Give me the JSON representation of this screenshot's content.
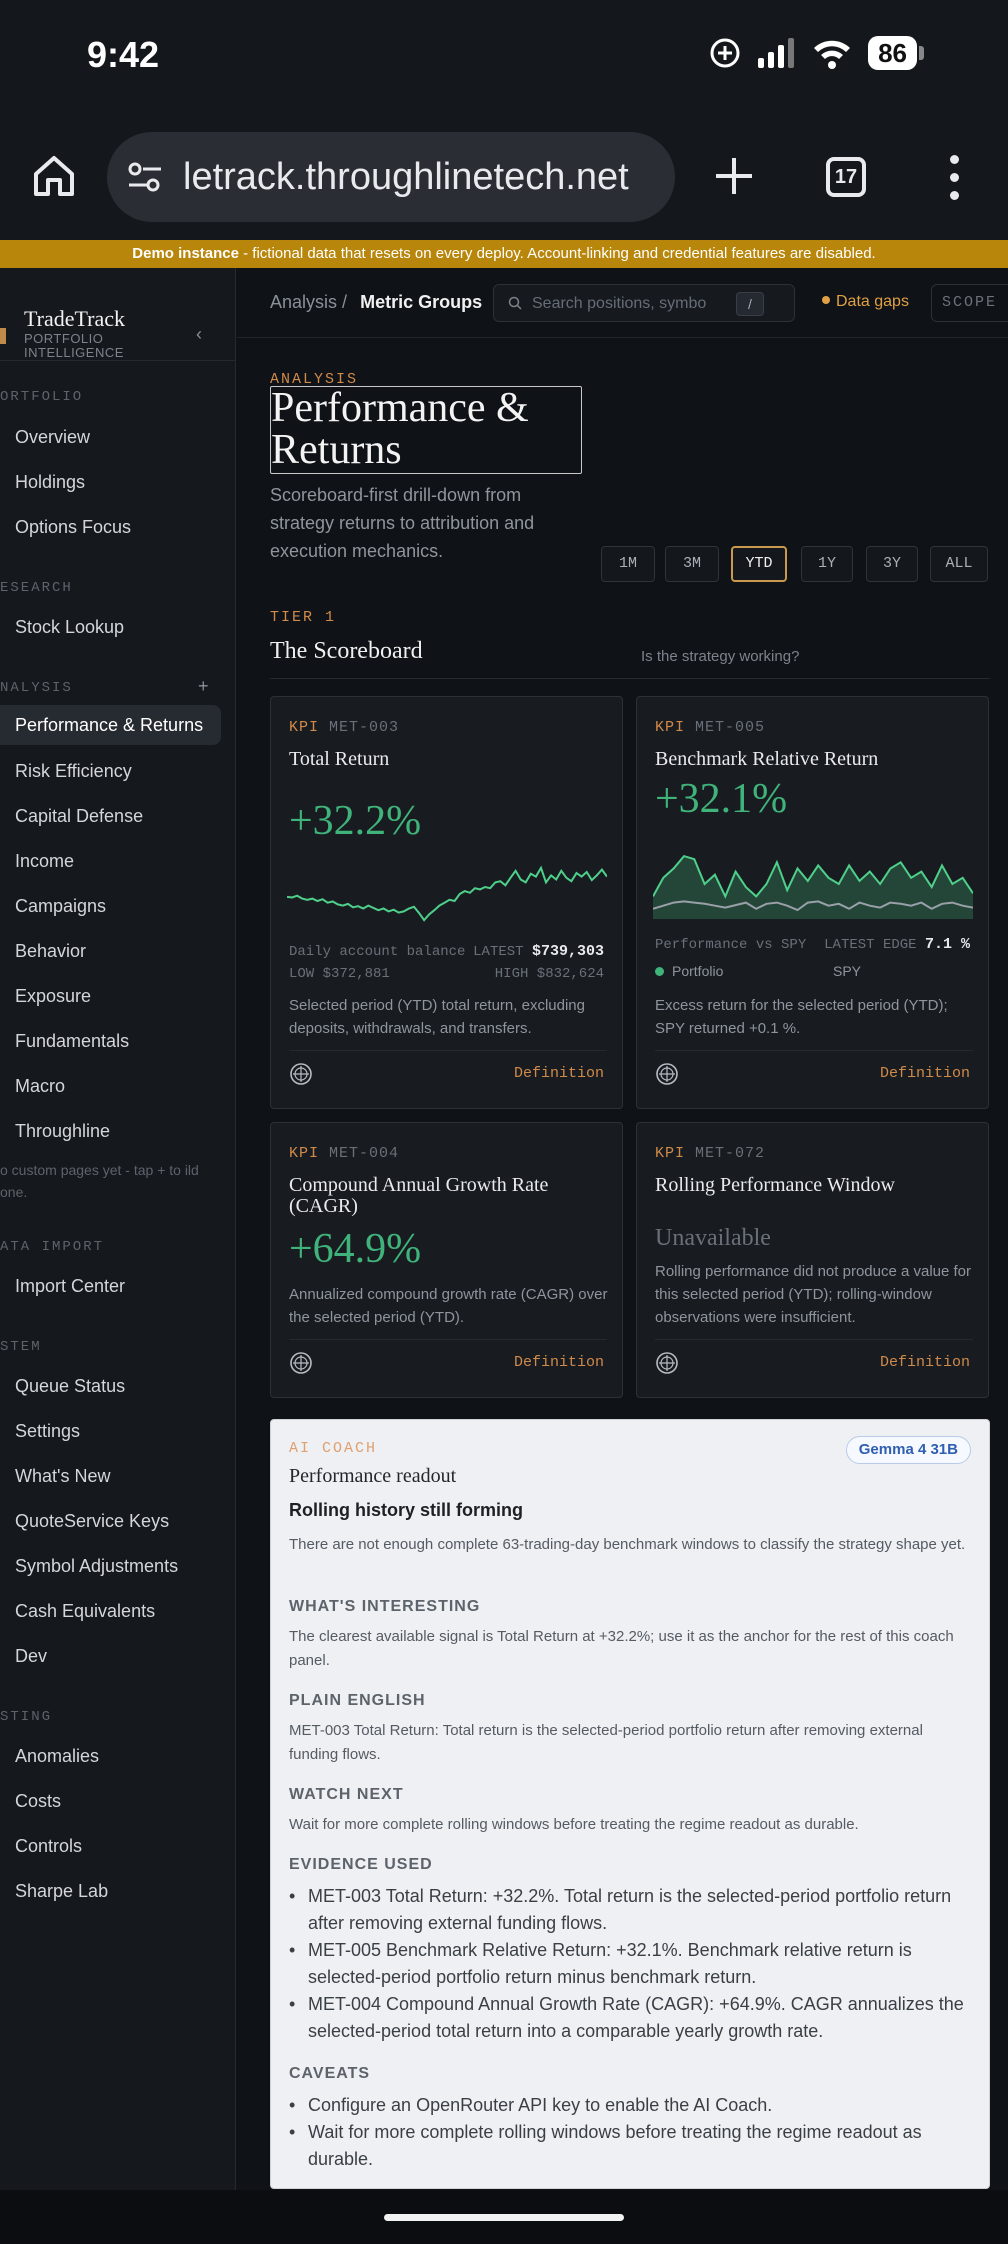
{
  "status": {
    "time": "9:42",
    "battery": "86"
  },
  "browser": {
    "url": "letrack.throughlinetech.net",
    "tab_count": "17"
  },
  "banner": {
    "bold": "Demo instance",
    "text": " - fictional data that resets on every deploy. Account-linking and credential features are disabled."
  },
  "brand": {
    "name": "TradeTrack",
    "subtitle": "PORTFOLIO INTELLIGENCE"
  },
  "sidebar": {
    "sections": {
      "portfolio": "ORTFOLIO",
      "research": "ESEARCH",
      "analysis": "NALYSIS",
      "data_import": "ATA IMPORT",
      "system": "STEM",
      "testing": "STING"
    },
    "portfolio_items": [
      "Overview",
      "Holdings",
      "Options Focus"
    ],
    "research_items": [
      "Stock Lookup"
    ],
    "analysis_items": [
      "Performance & Returns",
      "Risk Efficiency",
      "Capital Defense",
      "Income",
      "Campaigns",
      "Behavior",
      "Exposure",
      "Fundamentals",
      "Macro",
      "Throughline"
    ],
    "custom_hint": "o custom pages yet - tap + to ild one.",
    "import_items": [
      "Import Center"
    ],
    "system_items": [
      "Queue Status",
      "Settings",
      "What's New",
      "QuoteService Keys",
      "Symbol Adjustments",
      "Cash Equivalents",
      "Dev"
    ],
    "testing_items": [
      "Anomalies",
      "Costs",
      "Controls",
      "Sharpe Lab"
    ]
  },
  "topbar": {
    "crumb_root": "Analysis",
    "crumb_sep": "/",
    "crumb_current": "Metric Groups",
    "search_placeholder": "Search positions, symbo",
    "search_key": "/",
    "gaps": "Data gaps",
    "scope": "SCOPE"
  },
  "page": {
    "eyebrow": "ANALYSIS",
    "title": "Performance & Returns",
    "description": "Scoreboard-first drill-down from strategy returns to attribution and execution mechanics.",
    "periods": [
      "1M",
      "3M",
      "YTD",
      "1Y",
      "3Y",
      "ALL"
    ],
    "active_period": "YTD"
  },
  "tier": {
    "eyebrow": "TIER 1",
    "title": "The Scoreboard",
    "question": "Is the strategy working?"
  },
  "cards": {
    "total_return": {
      "kpi": "KPI",
      "code": "MET-003",
      "title": "Total Return",
      "value": "+32.2%",
      "meta_left": "Daily account balance",
      "latest_label": "LATEST",
      "latest_value": "$739,303",
      "low": "LOW $372,881",
      "high": "HIGH $832,624",
      "desc": "Selected period (YTD) total return, excluding deposits, withdrawals, and transfers.",
      "definition": "Definition"
    },
    "benchmark": {
      "kpi": "KPI",
      "code": "MET-005",
      "title": "Benchmark Relative Return",
      "value": "+32.1%",
      "meta_left": "Performance vs SPY",
      "edge_label": "LATEST EDGE",
      "edge_value": "7.1 %",
      "legend_portfolio": "Portfolio",
      "legend_spy": "SPY",
      "desc": "Excess return for the selected period (YTD); SPY returned +0.1 %.",
      "definition": "Definition"
    },
    "cagr": {
      "kpi": "KPI",
      "code": "MET-004",
      "title": "Compound Annual Growth Rate (CAGR)",
      "value": "+64.9%",
      "desc": "Annualized compound growth rate (CAGR) over the selected period (YTD).",
      "definition": "Definition"
    },
    "rolling": {
      "kpi": "KPI",
      "code": "MET-072",
      "title": "Rolling Performance Window",
      "value": "Unavailable",
      "desc": "Rolling performance did not produce a value for this selected period (YTD); rolling-window observations were insufficient.",
      "definition": "Definition"
    }
  },
  "coach": {
    "eyebrow": "AI COACH",
    "model": "Gemma 4 31B",
    "title": "Performance readout",
    "lead": "Rolling history still forming",
    "lead_text": "There are not enough complete 63-trading-day benchmark windows to classify the strategy shape yet.",
    "h_interesting": "WHAT'S INTERESTING",
    "interesting": "The clearest available signal is Total Return at +32.2%; use it as the anchor for the rest of this coach panel.",
    "h_plain": "PLAIN ENGLISH",
    "plain": "MET-003 Total Return: Total return is the selected-period portfolio return after removing external funding flows.",
    "h_watch": "WATCH NEXT",
    "watch": "Wait for more complete rolling windows before treating the regime readout as durable.",
    "h_evidence": "EVIDENCE USED",
    "evidence": [
      "MET-003 Total Return: +32.2%. Total return is the selected-period portfolio return after removing external funding flows.",
      "MET-005 Benchmark Relative Return: +32.1%. Benchmark relative return is selected-period portfolio return minus benchmark return.",
      "MET-004 Compound Annual Growth Rate (CAGR): +64.9%. CAGR annualizes the selected-period total return into a comparable yearly growth rate."
    ],
    "h_caveats": "CAVEATS",
    "caveats": [
      "Configure an OpenRouter API key to enable the AI Coach.",
      "Wait for more complete rolling windows before treating the regime readout as durable."
    ]
  },
  "chart_data": [
    {
      "type": "line",
      "title": "",
      "series": [
        {
          "name": "",
          "values": [
            0.45,
            0.44,
            0.47,
            0.42,
            0.4,
            0.42,
            0.38,
            0.41,
            0.35,
            0.37,
            0.32,
            0.3,
            0.33,
            0.27,
            0.29,
            0.25,
            0.3,
            0.26,
            0.22,
            0.25,
            0.2,
            0.23,
            0.18,
            0.2,
            0.25,
            0.28,
            0.17,
            0.05,
            0.15,
            0.22,
            0.3,
            0.35,
            0.4,
            0.38,
            0.5,
            0.55,
            0.52,
            0.6,
            0.58,
            0.62,
            0.6,
            0.7,
            0.72,
            0.65,
            0.78,
            0.9,
            0.75,
            0.7,
            0.85,
            0.8,
            0.95,
            0.7,
            0.82,
            0.75,
            0.9,
            0.78,
            0.72,
            0.86,
            0.8,
            0.88,
            0.74,
            0.82,
            0.92,
            0.8
          ]
        }
      ]
    },
    {
      "type": "area",
      "title": "",
      "series": [
        {
          "name": "Portfolio",
          "values": [
            0.3,
            0.6,
            0.75,
            0.95,
            0.9,
            0.5,
            0.65,
            0.3,
            0.7,
            0.45,
            0.3,
            0.5,
            0.85,
            0.4,
            0.75,
            0.55,
            0.8,
            0.6,
            0.5,
            0.8,
            0.55,
            0.7,
            0.5,
            0.75,
            0.85,
            0.6,
            0.7,
            0.45,
            0.8,
            0.5,
            0.6,
            0.35
          ]
        },
        {
          "name": "SPY",
          "values": [
            0.1,
            0.15,
            0.2,
            0.22,
            0.2,
            0.18,
            0.15,
            0.12,
            0.16,
            0.2,
            0.1,
            0.18,
            0.2,
            0.15,
            0.08,
            0.2,
            0.22,
            0.15,
            0.18,
            0.1,
            0.2,
            0.15,
            0.12,
            0.2,
            0.18,
            0.15,
            0.2,
            0.1,
            0.18,
            0.2,
            0.15,
            0.12
          ]
        }
      ]
    }
  ]
}
